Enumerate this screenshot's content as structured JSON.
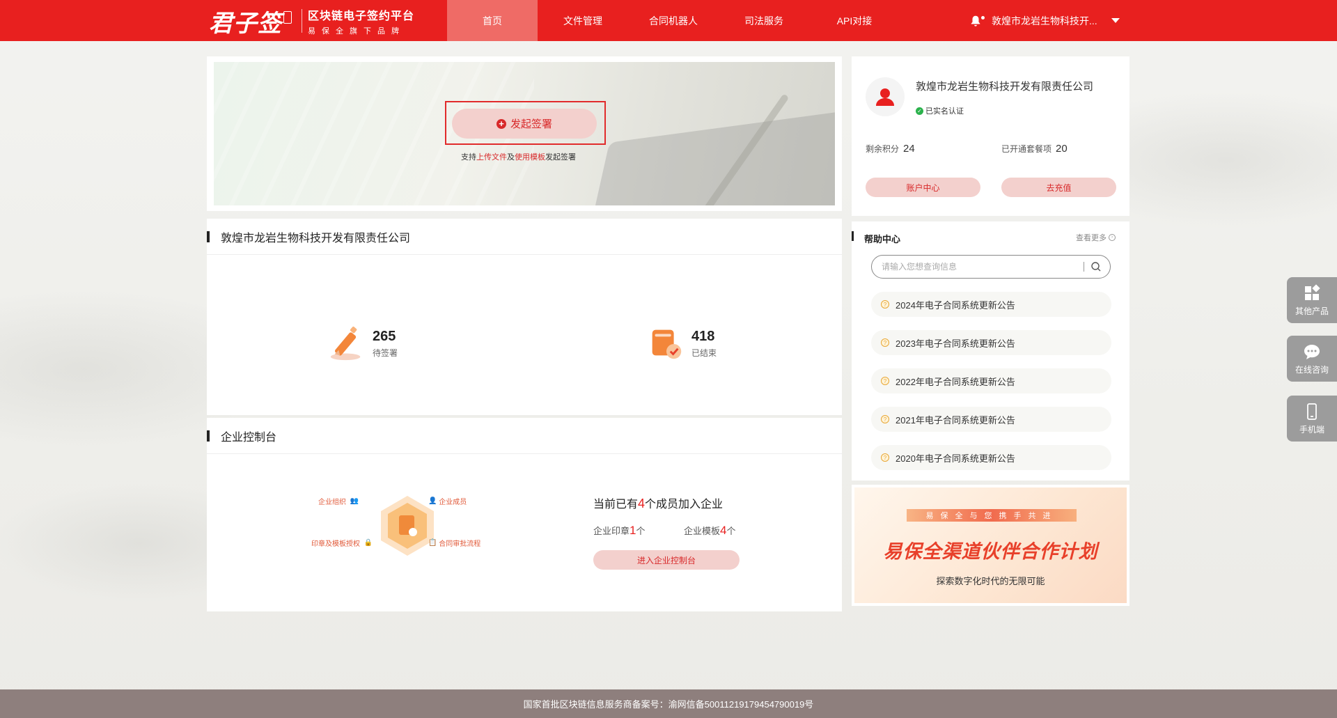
{
  "brand": {
    "logo_text": "君子签",
    "title": "区块链电子签约平台",
    "subtitle": "易保全旗下品牌"
  },
  "nav": {
    "items": [
      {
        "label": "首页",
        "active": true
      },
      {
        "label": "文件管理",
        "active": false
      },
      {
        "label": "合同机器人",
        "active": false
      },
      {
        "label": "司法服务",
        "active": false
      },
      {
        "label": "API对接",
        "active": false
      }
    ],
    "user_name": "敦煌市龙岩生物科技开..."
  },
  "hero": {
    "start_label": "发起签署",
    "hint_prefix": "支持",
    "hint_upload": "上传文件",
    "hint_and": "及",
    "hint_template": "使用模板",
    "hint_suffix": "发起签署"
  },
  "company": {
    "title": "敦煌市龙岩生物科技开发有限责任公司",
    "stats": [
      {
        "value": "265",
        "label": "待签署"
      },
      {
        "value": "418",
        "label": "已结束"
      }
    ]
  },
  "console": {
    "title": "企业控制台",
    "diagram": {
      "org": "企业组织",
      "members": "企业成员",
      "seal_auth": "印章及模板授权",
      "approval": "合同审批流程"
    },
    "members_prefix": "当前已有",
    "members_count": "4",
    "members_suffix": "个成员加入企业",
    "seal_label": "企业印章",
    "seal_count": "1",
    "seal_unit": "个",
    "template_label": "企业模板",
    "template_count": "4",
    "template_unit": "个",
    "enter_label": "进入企业控制台"
  },
  "profile": {
    "company_name": "敦煌市龙岩生物科技开发有限责任公司",
    "verified_label": "已实名认证",
    "points_label": "剩余积分",
    "points_value": "24",
    "packages_label": "已开通套餐项",
    "packages_value": "20",
    "account_center_label": "账户中心",
    "recharge_label": "去充值"
  },
  "help": {
    "title": "帮助中心",
    "more_label": "查看更多",
    "search_placeholder": "请输入您想查询信息",
    "notices": [
      "2024年电子合同系统更新公告",
      "2023年电子合同系统更新公告",
      "2022年电子合同系统更新公告",
      "2021年电子合同系统更新公告",
      "2020年电子合同系统更新公告"
    ]
  },
  "promo": {
    "banner": "易保全与您携手共进",
    "title": "易保全渠道伙伴合作计划",
    "subtitle": "探索数字化时代的无限可能"
  },
  "side": {
    "other_products": "其他产品",
    "online_consult": "在线咨询",
    "mobile": "手机端"
  },
  "footer": {
    "text": "国家首批区块链信息服务商备案号：渝网信备50011219179454790019号"
  },
  "colors": {
    "primary": "#e8201f",
    "nav_active": "#ef6b66",
    "button_bg": "#f3d0cd",
    "footer_bg": "#8e7f7d"
  }
}
